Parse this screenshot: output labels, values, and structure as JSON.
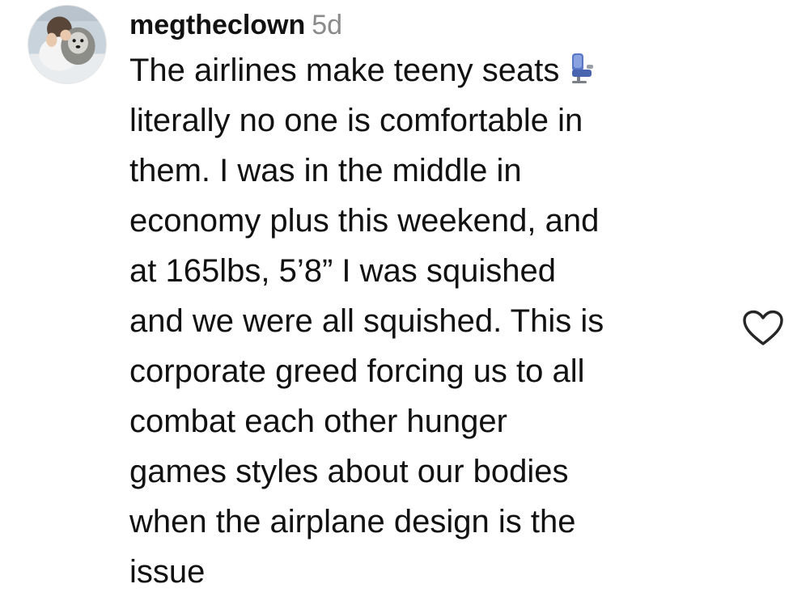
{
  "comment": {
    "username": "megtheclown",
    "timestamp": "5d",
    "emoji": "seat",
    "lines": [
      "The airlines make teeny seats",
      "literally no one is comfortable in",
      "them. I was in the middle in",
      "economy plus this weekend, and",
      "at 165lbs, 5’8” I was squished",
      "and we were all squished. This is",
      "corporate greed forcing us to all",
      "combat each other hunger",
      "games styles about our bodies",
      "when the airplane design is the",
      "issue"
    ]
  },
  "icons": {
    "like": "heart-outline-icon",
    "seat": "airplane-seat-emoji-icon"
  },
  "colors": {
    "text": "#111111",
    "timestamp": "#8a8a8a",
    "icon_stroke": "#262626",
    "seat_emoji": "#5a78c8"
  }
}
